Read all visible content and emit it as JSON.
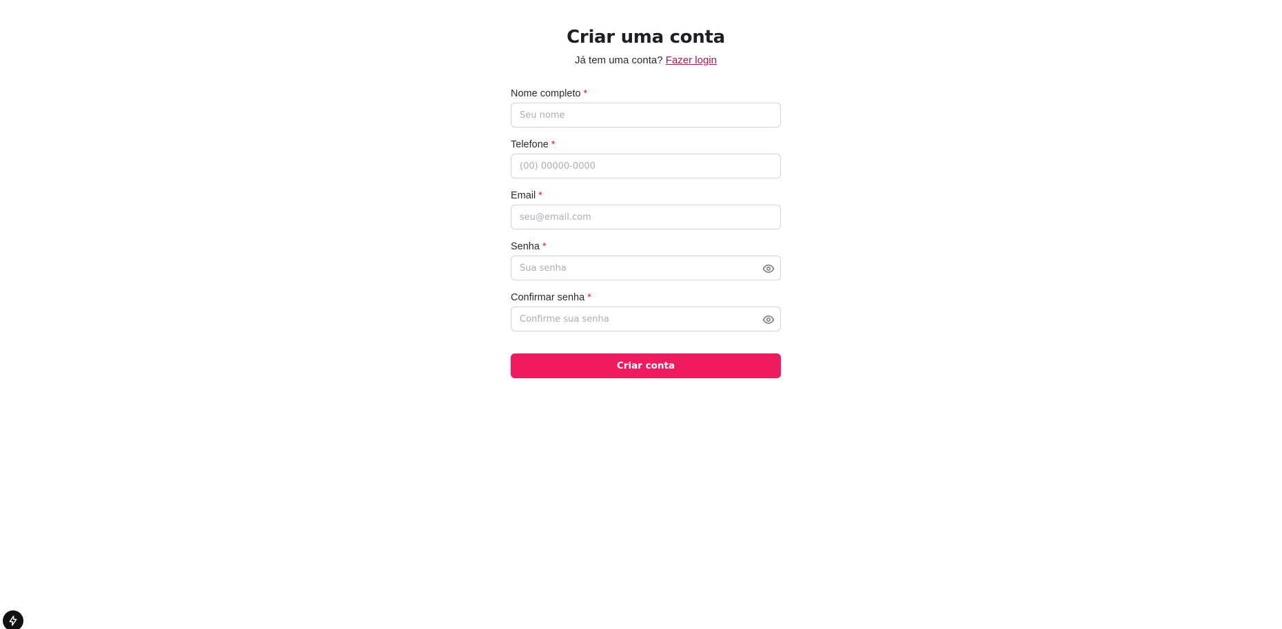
{
  "header": {
    "title": "Criar uma conta",
    "subtitle_text": "Já tem uma conta?",
    "login_link": "Fazer login"
  },
  "form": {
    "required_marker": "*",
    "fields": {
      "name": {
        "label": "Nome completo",
        "placeholder": "Seu nome",
        "value": ""
      },
      "phone": {
        "label": "Telefone",
        "placeholder": "(00) 00000-0000",
        "value": ""
      },
      "email": {
        "label": "Email",
        "placeholder": "seu@email.com",
        "value": ""
      },
      "password": {
        "label": "Senha",
        "placeholder": "Sua senha",
        "value": ""
      },
      "confirm_password": {
        "label": "Confirmar senha",
        "placeholder": "Confirme sua senha",
        "value": ""
      }
    },
    "submit_label": "Criar conta"
  },
  "icons": {
    "password_toggle": "eye-icon",
    "corner_badge": "lightning-icon"
  },
  "colors": {
    "accent": "#f01a5e",
    "link": "#a3195b",
    "required": "#e8154f",
    "input_border": "#ced4da"
  }
}
